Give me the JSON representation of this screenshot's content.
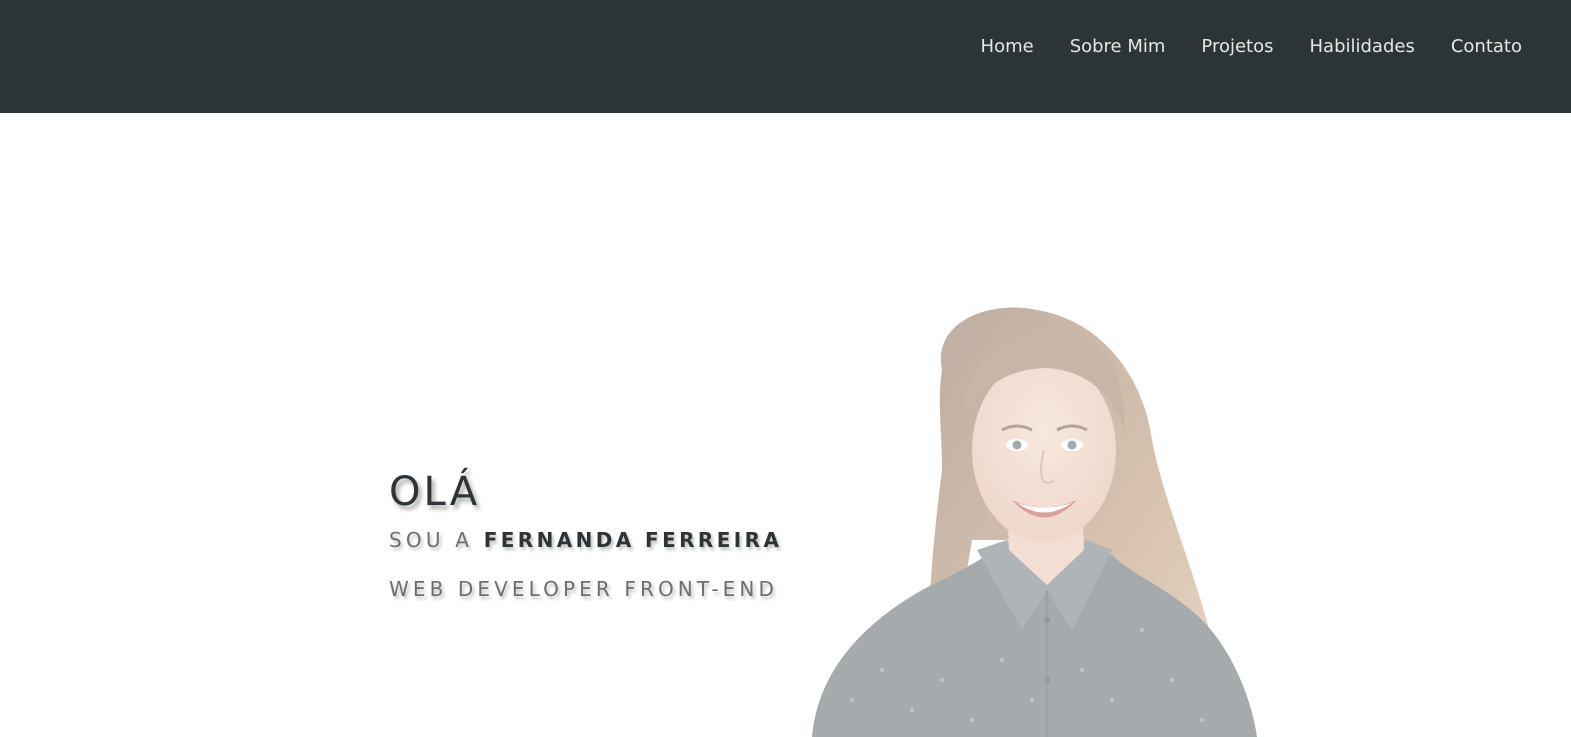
{
  "nav": {
    "items": [
      {
        "label": "Home"
      },
      {
        "label": "Sobre Mim"
      },
      {
        "label": "Projetos"
      },
      {
        "label": "Habilidades"
      },
      {
        "label": "Contato"
      }
    ]
  },
  "hero": {
    "greeting": "OLÁ",
    "intro_prefix": "SOU A ",
    "name": "FERNANDA FERREIRA",
    "role": "WEB DEVELOPER FRONT-END"
  },
  "colors": {
    "navbar_bg": "#2d3437",
    "nav_text": "#e6e6e6",
    "heading_text": "#2d3437",
    "muted_text": "#6a6f72"
  }
}
